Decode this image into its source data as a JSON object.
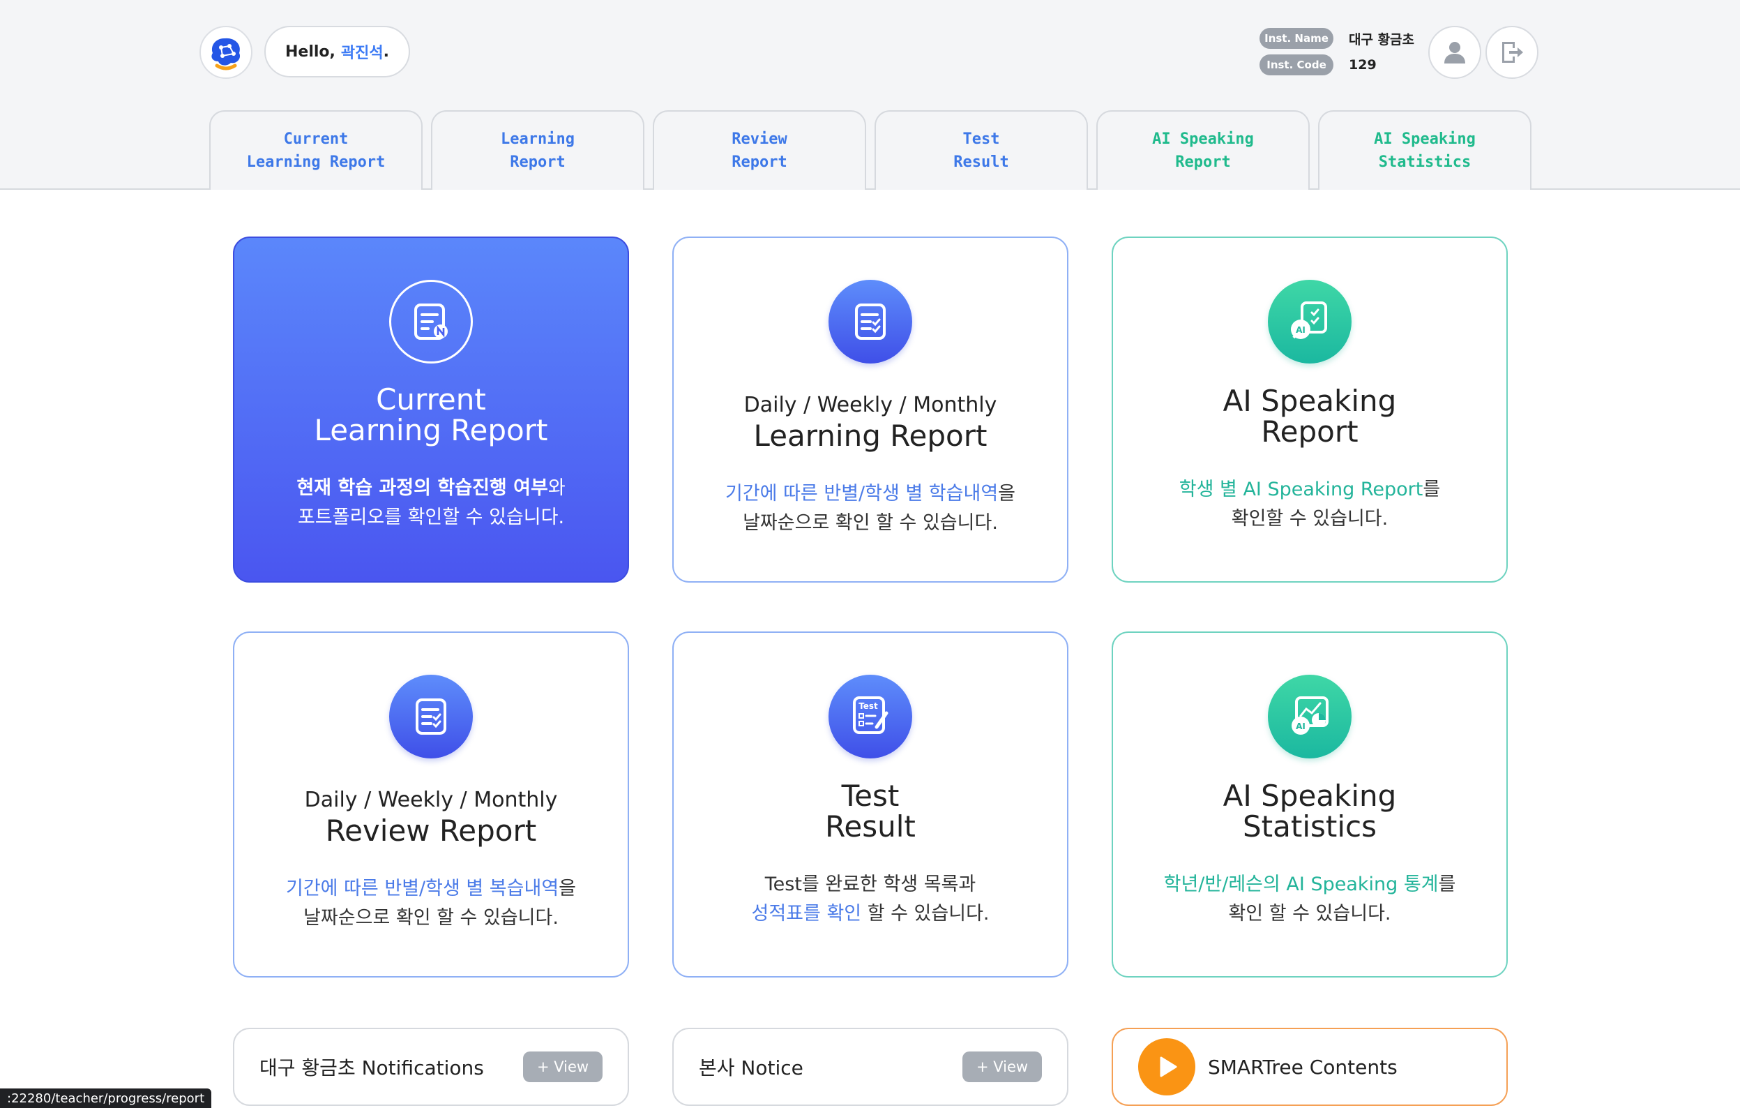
{
  "header": {
    "greeting_prefix": "Hello,",
    "user_name": "곽진석",
    "greeting_suffix": ".",
    "inst_name_label": "Inst. Name",
    "inst_name_value": "대구 황금초",
    "inst_code_label": "Inst. Code",
    "inst_code_value": "129"
  },
  "tabs": [
    {
      "line1": "Current",
      "line2": "Learning Report",
      "color": "#3d78e8"
    },
    {
      "line1": "Learning",
      "line2": "Report",
      "color": "#3d78e8"
    },
    {
      "line1": "Review",
      "line2": "Report",
      "color": "#3d78e8"
    },
    {
      "line1": "Test",
      "line2": "Result",
      "color": "#3d78e8"
    },
    {
      "line1": "AI Speaking",
      "line2": "Report",
      "color": "#1fba8c"
    },
    {
      "line1": "AI Speaking",
      "line2": "Statistics",
      "color": "#1fba8c"
    }
  ],
  "cards": {
    "current": {
      "title1": "Current",
      "title2": "Learning Report",
      "desc_strong": "현재 학습 과정의 학습진행 여부",
      "desc_rest1": "와",
      "desc_line2": "포트폴리오를 확인할 수 있습니다."
    },
    "learning": {
      "subtitle": "Daily / Weekly / Monthly",
      "title": "Learning Report",
      "desc_hl": "기간에 따른 반별/학생 별 학습내역",
      "desc_rest1": "을",
      "desc_line2": "날짜순으로 확인 할 수 있습니다."
    },
    "ai_report": {
      "title1": "AI Speaking",
      "title2": "Report",
      "desc_hl": "학생 별 AI Speaking Report",
      "desc_rest1": "를",
      "desc_line2": "확인할 수 있습니다."
    },
    "review": {
      "subtitle": "Daily / Weekly / Monthly",
      "title": "Review Report",
      "desc_hl": "기간에 따른 반별/학생 별 복습내역",
      "desc_rest1": "을",
      "desc_line2": "날짜순으로 확인 할 수 있습니다."
    },
    "test": {
      "title1": "Test",
      "title2": "Result",
      "icon_text": "Test",
      "desc_line1": "Test를 완료한 학생 목록과",
      "desc_hl": "성적표를 확인",
      "desc_rest2": " 할 수 있습니다."
    },
    "ai_stats": {
      "title1": "AI Speaking",
      "title2": "Statistics",
      "desc_hl": "학년/반/레슨의 AI Speaking 통계",
      "desc_rest1": "를",
      "desc_line2": "확인 할 수 있습니다."
    }
  },
  "ai_badge": "AI",
  "bottom": {
    "notifications": "대구 황금초 Notifications",
    "notice": "본사 Notice",
    "view_label": "+ View",
    "contents": "SMARTree Contents"
  },
  "status_url": ":22280/teacher/progress/report"
}
